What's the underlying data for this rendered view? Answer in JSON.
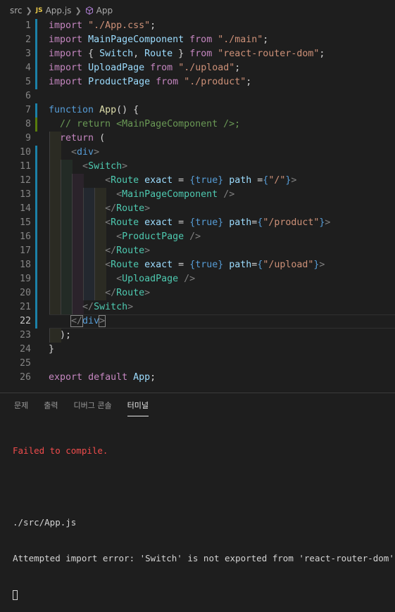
{
  "breadcrumb": {
    "folder": "src",
    "file_icon": "JS",
    "file": "App.js",
    "symbol": "App"
  },
  "code": {
    "current_line": 22,
    "lines": [
      {
        "n": "1"
      },
      {
        "n": "2"
      },
      {
        "n": "3"
      },
      {
        "n": "4"
      },
      {
        "n": "5"
      },
      {
        "n": "6"
      },
      {
        "n": "7"
      },
      {
        "n": "8"
      },
      {
        "n": "9"
      },
      {
        "n": "10"
      },
      {
        "n": "11"
      },
      {
        "n": "12"
      },
      {
        "n": "13"
      },
      {
        "n": "14"
      },
      {
        "n": "15"
      },
      {
        "n": "16"
      },
      {
        "n": "17"
      },
      {
        "n": "18"
      },
      {
        "n": "19"
      },
      {
        "n": "20"
      },
      {
        "n": "21"
      },
      {
        "n": "22"
      },
      {
        "n": "23"
      },
      {
        "n": "24"
      },
      {
        "n": "25"
      },
      {
        "n": "26"
      }
    ]
  },
  "tabs": {
    "problems": "문제",
    "output": "출력",
    "debug_console": "디버그 콘솔",
    "terminal": "터미널"
  },
  "terminal": {
    "error": "Failed to compile.",
    "file": "./src/App.js",
    "message": "Attempted import error: 'Switch' is not exported from 'react-router-dom'."
  },
  "colors": {
    "background": "#1e1e1e",
    "keyword": "#c586c0",
    "string": "#ce9178",
    "tag": "#4ec9b0",
    "error": "#f14c4c"
  }
}
